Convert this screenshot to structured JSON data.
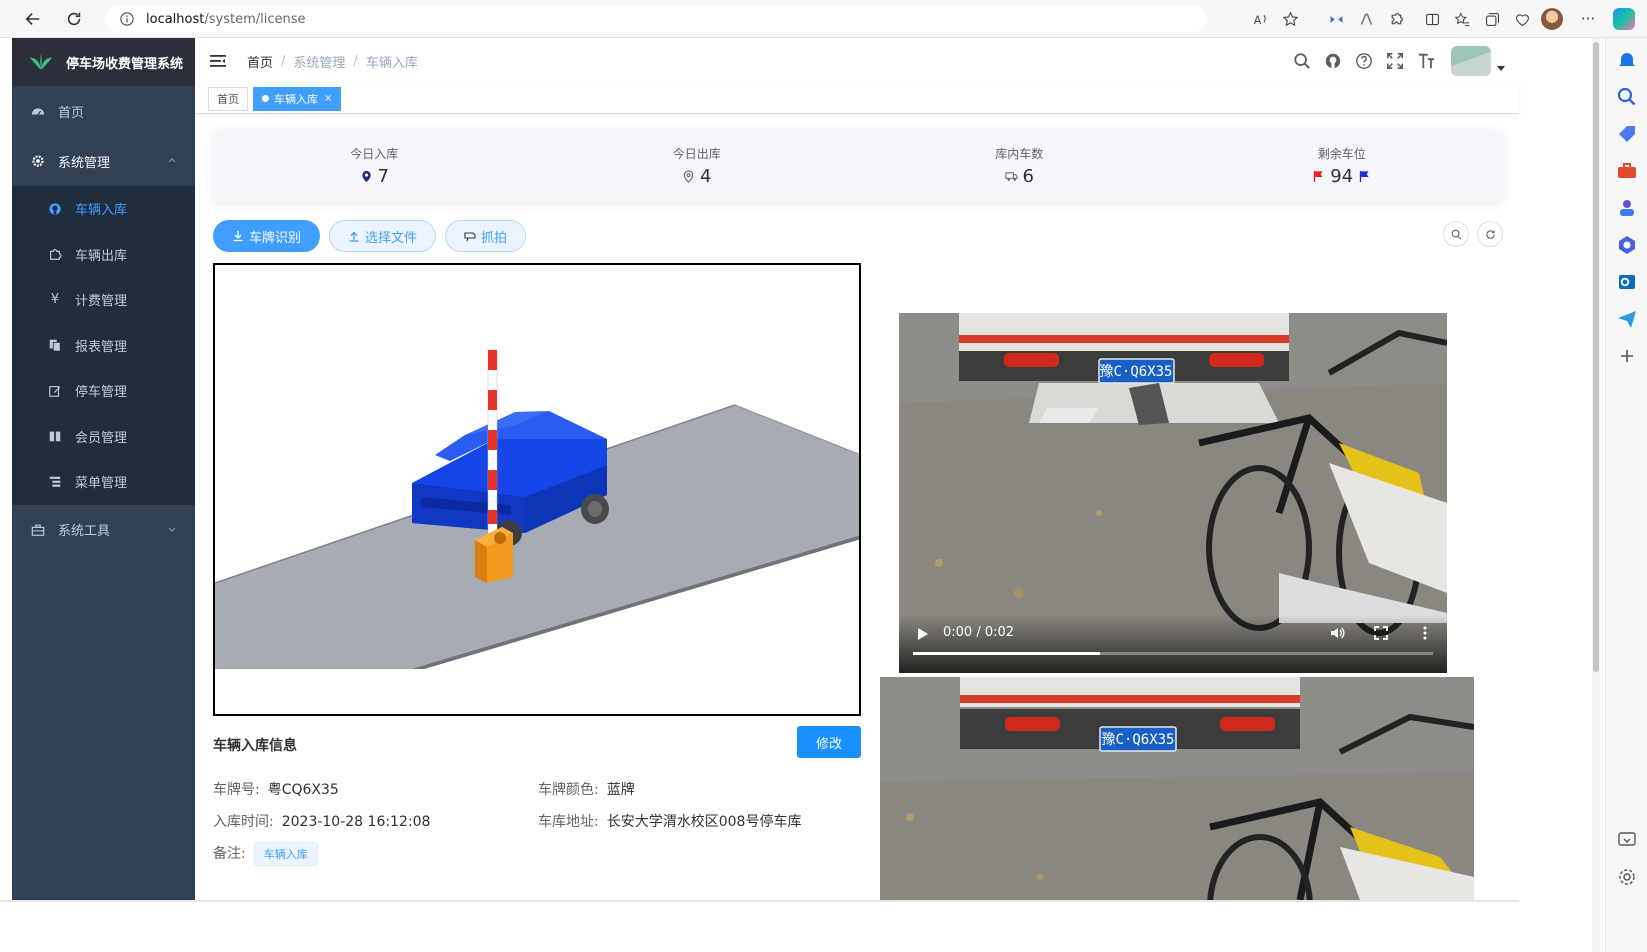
{
  "browser": {
    "url_host": "localhost",
    "url_path": "/system/license"
  },
  "sidebar": {
    "app_title": "停车场收费管理系统",
    "items": [
      {
        "label": "首页",
        "icon": "dashboard-icon"
      },
      {
        "label": "系统管理",
        "icon": "gear-icon",
        "expanded": true
      },
      {
        "label": "系统工具",
        "icon": "toolbox-icon",
        "expanded": false
      }
    ],
    "submenu": [
      {
        "label": "车辆入库",
        "icon": "github-icon",
        "active": true
      },
      {
        "label": "车辆出库",
        "icon": "puzzle-icon"
      },
      {
        "label": "计费管理",
        "icon": "yen-icon"
      },
      {
        "label": "报表管理",
        "icon": "copy-icon"
      },
      {
        "label": "停车管理",
        "icon": "edit-icon"
      },
      {
        "label": "会员管理",
        "icon": "book-icon"
      },
      {
        "label": "菜单管理",
        "icon": "tree-table-icon"
      }
    ]
  },
  "breadcrumb": [
    "首页",
    "系统管理",
    "车辆入库"
  ],
  "tags": [
    {
      "label": "首页",
      "active": false
    },
    {
      "label": "车辆入库",
      "active": true
    }
  ],
  "stats": [
    {
      "label": "今日入库",
      "value": "7",
      "icon": "location-pin-icon"
    },
    {
      "label": "今日出库",
      "value": "4",
      "icon": "location-pin-outline-icon"
    },
    {
      "label": "库内车数",
      "value": "6",
      "icon": "truck-icon"
    },
    {
      "label": "剩余车位",
      "value": "94",
      "icon": "flag-icon"
    }
  ],
  "toolbar": {
    "recognize_label": "车牌识别",
    "select_file_label": "选择文件",
    "capture_label": "抓拍"
  },
  "info": {
    "title": "车辆入库信息",
    "edit_label": "修改",
    "plate_label": "车牌号:",
    "plate_value": "粤CQ6X35",
    "color_label": "车牌颜色:",
    "color_value": "蓝牌",
    "time_label": "入库时间:",
    "time_value": "2023-10-28 16:12:08",
    "address_label": "车库地址:",
    "address_value": "长安大学渭水校区008号停车库",
    "remark_label": "备注:",
    "remark_value": "车辆入库"
  },
  "video": {
    "time": "0:00 / 0:02",
    "progress": 0.36
  },
  "photo_plate": "豫C·Q6X35",
  "colors": {
    "sidebar_bg": "#304156",
    "submenu_bg": "#1f2d3d",
    "primary": "#409eff",
    "car_blue": "#1646e8",
    "barrier_orange": "#f39a1e"
  }
}
